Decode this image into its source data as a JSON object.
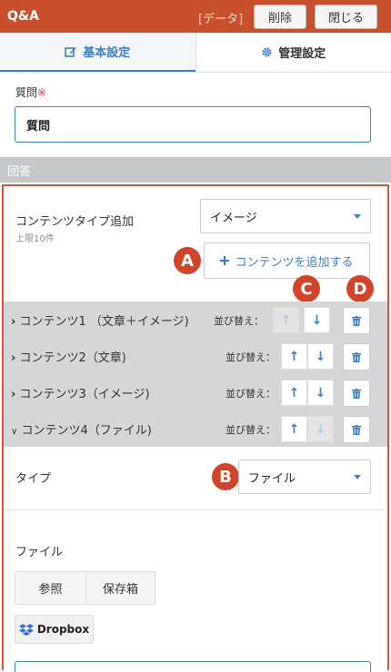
{
  "header": {
    "title": "Q&A",
    "data_tag": "[データ]",
    "delete_label": "削除",
    "close_label": "閉じる"
  },
  "tabs": [
    {
      "label": "基本設定",
      "icon": "edit-icon",
      "active": true
    },
    {
      "label": "管理設定",
      "icon": "gear-icon",
      "active": false
    }
  ],
  "question": {
    "label": "質問",
    "required_mark": "※",
    "value": "質問"
  },
  "answer": {
    "section_label": "回答",
    "add_type": {
      "label": "コンテンツタイプ追加",
      "sublabel": "上限10件",
      "selected": "イメージ"
    },
    "add_button_label": "コンテンツを追加する",
    "contents": [
      {
        "name": "コンテンツ1 （文章＋イメージ)",
        "expanded": false,
        "up_enabled": false,
        "down_enabled": true
      },
      {
        "name": "コンテンツ2（文章)",
        "expanded": false,
        "up_enabled": true,
        "down_enabled": true
      },
      {
        "name": "コンテンツ3（イメージ)",
        "expanded": false,
        "up_enabled": true,
        "down_enabled": true
      },
      {
        "name": "コンテンツ4（ファイル)",
        "expanded": true,
        "up_enabled": true,
        "down_enabled": false
      }
    ],
    "sort_label": "並び替え：",
    "type_label": "タイプ",
    "type_selected": "ファイル",
    "file_label": "ファイル",
    "browse_label": "参照",
    "storage_label": "保存箱",
    "dropbox_label": "Dropbox"
  },
  "markers": [
    "A",
    "B",
    "C",
    "D"
  ],
  "colors": {
    "header_bg": "#c9502c",
    "accent": "#3d7ec6",
    "marker": "#d0452a",
    "answer_border": "#d5553a",
    "required": "#e33333"
  }
}
